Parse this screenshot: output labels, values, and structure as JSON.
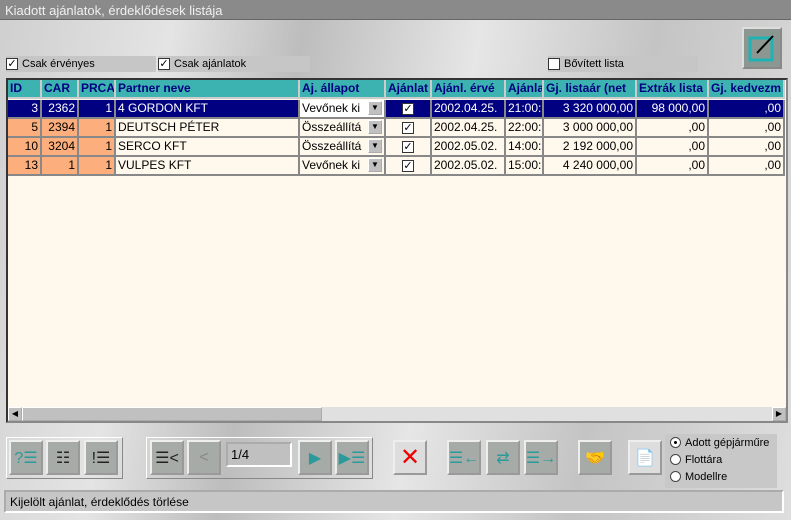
{
  "window": {
    "title": "Kiadott ajánlatok, érdeklődések listája"
  },
  "filters": [
    {
      "label": "Csak érvényes",
      "checked": true
    },
    {
      "label": "Csak ajánlatok",
      "checked": true
    },
    {
      "label": "Bővített lista",
      "checked": false
    }
  ],
  "table": {
    "columns": [
      "ID",
      "CAR",
      "PRCA",
      "Partner neve",
      "Aj. állapot",
      "Ajánlat",
      "Ajánl. érvé",
      "Ajánla",
      "Gj. listaár (net",
      "Extrák lista",
      "Gj. kedvezm"
    ],
    "rows": [
      {
        "id": "3",
        "car": "2362",
        "prca": "1",
        "partner": "4 GORDON KFT",
        "status": "Vevőnek ki",
        "offer": true,
        "valid": "2002.04.25.",
        "time": "21:00:",
        "list_price": "3 320 000,00",
        "extras": "98 000,00",
        "discount": ",00",
        "selected": true
      },
      {
        "id": "5",
        "car": "2394",
        "prca": "1",
        "partner": "DEUTSCH PÉTER",
        "status": "Összeállítá",
        "offer": true,
        "valid": "2002.04.25.",
        "time": "22:00:",
        "list_price": "3 000 000,00",
        "extras": ",00",
        "discount": ",00"
      },
      {
        "id": "10",
        "car": "3204",
        "prca": "1",
        "partner": "SERCO KFT",
        "status": "Összeállítá",
        "offer": true,
        "valid": "2002.05.02.",
        "time": "14:00:",
        "list_price": "2 192 000,00",
        "extras": ",00",
        "discount": ",00"
      },
      {
        "id": "13",
        "car": "1",
        "prca": "1",
        "partner": "VULPES KFT",
        "status": "Vevőnek ki",
        "offer": true,
        "valid": "2002.05.02.",
        "time": "15:00:",
        "list_price": "4 240 000,00",
        "extras": ",00",
        "discount": ",00"
      }
    ]
  },
  "pager": {
    "value": "1/4"
  },
  "scope": {
    "options": [
      "Adott gépjárműre",
      "Flottára",
      "Modellre"
    ],
    "selected": 0
  },
  "status_bar": {
    "text": "Kijelölt ajánlat, érdeklődés törlése"
  }
}
